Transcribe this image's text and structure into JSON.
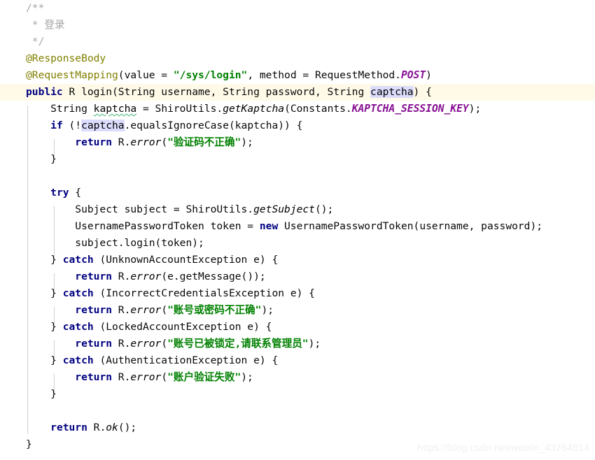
{
  "editor": {
    "language": "Java",
    "theme": "IntelliJ Light",
    "colors": {
      "background": "#ffffff",
      "current_line": "#fffae8",
      "keyword": "#000080",
      "comment": "#a5a5a5",
      "annotation": "#808000",
      "string": "#008000",
      "static_field": "#871094",
      "identifier_occurrence_highlight": "#dcdcfc",
      "weak_warning_underline": "#3cb371",
      "indent_guide": "#d0d0d0",
      "watermark": "#f0f0f0"
    }
  },
  "code": {
    "lines": [
      {
        "n": 1,
        "indent": 0,
        "current": false,
        "text": "/**"
      },
      {
        "n": 2,
        "indent": 0,
        "current": false,
        "text": " * 登录"
      },
      {
        "n": 3,
        "indent": 0,
        "current": false,
        "text": " */"
      },
      {
        "n": 4,
        "indent": 0,
        "current": false,
        "text": "@ResponseBody"
      },
      {
        "n": 5,
        "indent": 0,
        "current": false,
        "text": "@RequestMapping(value = \"/sys/login\", method = RequestMethod.POST)"
      },
      {
        "n": 6,
        "indent": 0,
        "current": true,
        "text": "public R login(String username, String password, String captcha) {"
      },
      {
        "n": 7,
        "indent": 1,
        "current": false,
        "text": "    String kaptcha = ShiroUtils.getKaptcha(Constants.KAPTCHA_SESSION_KEY);"
      },
      {
        "n": 8,
        "indent": 1,
        "current": false,
        "text": "    if (!captcha.equalsIgnoreCase(kaptcha)) {"
      },
      {
        "n": 9,
        "indent": 2,
        "current": false,
        "text": "        return R.error(\"验证码不正确\");"
      },
      {
        "n": 10,
        "indent": 1,
        "current": false,
        "text": "    }"
      },
      {
        "n": 11,
        "indent": 1,
        "current": false,
        "text": ""
      },
      {
        "n": 12,
        "indent": 1,
        "current": false,
        "text": "    try {"
      },
      {
        "n": 13,
        "indent": 2,
        "current": false,
        "text": "        Subject subject = ShiroUtils.getSubject();"
      },
      {
        "n": 14,
        "indent": 2,
        "current": false,
        "text": "        UsernamePasswordToken token = new UsernamePasswordToken(username, password);"
      },
      {
        "n": 15,
        "indent": 2,
        "current": false,
        "text": "        subject.login(token);"
      },
      {
        "n": 16,
        "indent": 1,
        "current": false,
        "text": "    } catch (UnknownAccountException e) {"
      },
      {
        "n": 17,
        "indent": 2,
        "current": false,
        "text": "        return R.error(e.getMessage());"
      },
      {
        "n": 18,
        "indent": 1,
        "current": false,
        "text": "    } catch (IncorrectCredentialsException e) {"
      },
      {
        "n": 19,
        "indent": 2,
        "current": false,
        "text": "        return R.error(\"账号或密码不正确\");"
      },
      {
        "n": 20,
        "indent": 1,
        "current": false,
        "text": "    } catch (LockedAccountException e) {"
      },
      {
        "n": 21,
        "indent": 2,
        "current": false,
        "text": "        return R.error(\"账号已被锁定,请联系管理员\");"
      },
      {
        "n": 22,
        "indent": 1,
        "current": false,
        "text": "    } catch (AuthenticationException e) {"
      },
      {
        "n": 23,
        "indent": 2,
        "current": false,
        "text": "        return R.error(\"账户验证失败\");"
      },
      {
        "n": 24,
        "indent": 1,
        "current": false,
        "text": "    }"
      },
      {
        "n": 25,
        "indent": 1,
        "current": false,
        "text": ""
      },
      {
        "n": 26,
        "indent": 1,
        "current": false,
        "text": "    return R.ok();"
      },
      {
        "n": 27,
        "indent": 0,
        "current": false,
        "text": "}"
      }
    ],
    "strings": [
      "/sys/login",
      "验证码不正确",
      "账号或密码不正确",
      "账号已被锁定,请联系管理员",
      "账户验证失败"
    ],
    "keywords": [
      "public",
      "if",
      "return",
      "try",
      "catch",
      "new"
    ],
    "annotations": [
      "@ResponseBody",
      "@RequestMapping"
    ],
    "static_fields": [
      "POST",
      "KAPTCHA_SESSION_KEY"
    ],
    "comment_text": "登录",
    "highlighted_identifier": "captcha",
    "warning_identifier": "kaptcha"
  },
  "watermark": {
    "text": "https://blog.csdn.net/weixin_43764814"
  }
}
